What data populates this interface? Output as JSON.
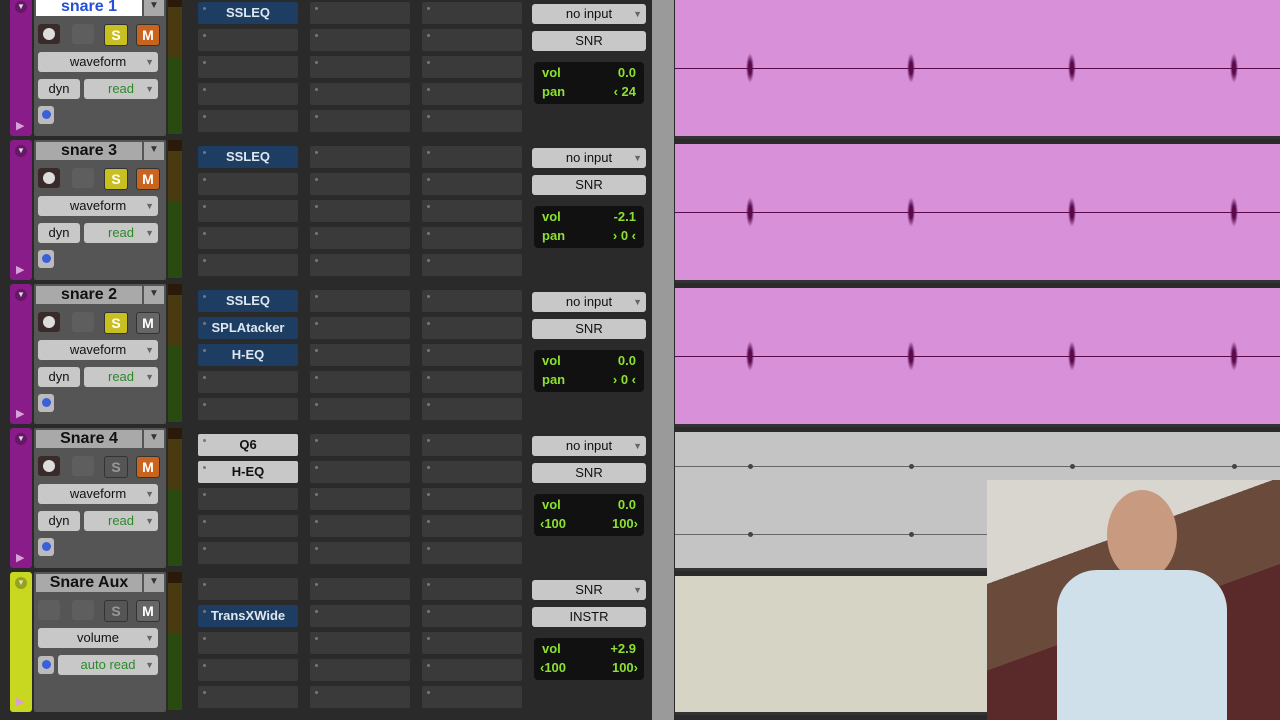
{
  "tracks": [
    {
      "name": "snare 1",
      "selected": true,
      "color": "#8a1c8a",
      "solo_on": true,
      "mute_on": true,
      "view": "waveform",
      "dyn": "dyn",
      "auto": "read",
      "inserts_a": [
        "SSLEQ"
      ],
      "plug_style": "blue",
      "input": "no input",
      "output": "SNR",
      "vol_label": "vol",
      "vol": "0.0",
      "pan_label": "pan",
      "pan": "‹ 24",
      "kind": "audio"
    },
    {
      "name": "snare 3",
      "selected": false,
      "color": "#8a1c8a",
      "solo_on": true,
      "mute_on": true,
      "view": "waveform",
      "dyn": "dyn",
      "auto": "read",
      "inserts_a": [
        "SSLEQ"
      ],
      "plug_style": "blue",
      "input": "no input",
      "output": "SNR",
      "vol_label": "vol",
      "vol": "-2.1",
      "pan_label": "pan",
      "pan": "› 0 ‹",
      "kind": "audio"
    },
    {
      "name": "snare 2",
      "selected": false,
      "color": "#8a1c8a",
      "solo_on": true,
      "mute_on": false,
      "view": "waveform",
      "dyn": "dyn",
      "auto": "read",
      "inserts_a": [
        "SSLEQ",
        "SPLAtacker",
        "H-EQ"
      ],
      "plug_style": "blue",
      "input": "no input",
      "output": "SNR",
      "vol_label": "vol",
      "vol": "0.0",
      "pan_label": "pan",
      "pan": "› 0 ‹",
      "kind": "audio"
    },
    {
      "name": "Snare 4",
      "selected": false,
      "color": "#8a1c8a",
      "solo_on": false,
      "mute_on": true,
      "view": "waveform",
      "dyn": "dyn",
      "auto": "read",
      "inserts_a": [
        "Q6",
        "H-EQ"
      ],
      "plug_style": "grey",
      "input": "no input",
      "output": "SNR",
      "vol_label": "vol",
      "vol": "0.0",
      "pan_l": "‹100",
      "pan_r": "100›",
      "kind": "stereo"
    },
    {
      "name": "Snare Aux",
      "selected": false,
      "color": "#c8d820",
      "solo_on": false,
      "mute_on": false,
      "view": "volume",
      "auto": "auto read",
      "inserts_a": [
        "",
        "TransXWide"
      ],
      "plug_style": "blue",
      "input": "SNR",
      "output": "INSTR",
      "vol_label": "vol",
      "vol": "+2.9",
      "pan_l": "‹100",
      "pan_r": "100›",
      "kind": "aux"
    }
  ],
  "colors": {
    "clip_pink": "#d890d8",
    "solo": "#c8c020",
    "mute": "#d86a20"
  }
}
